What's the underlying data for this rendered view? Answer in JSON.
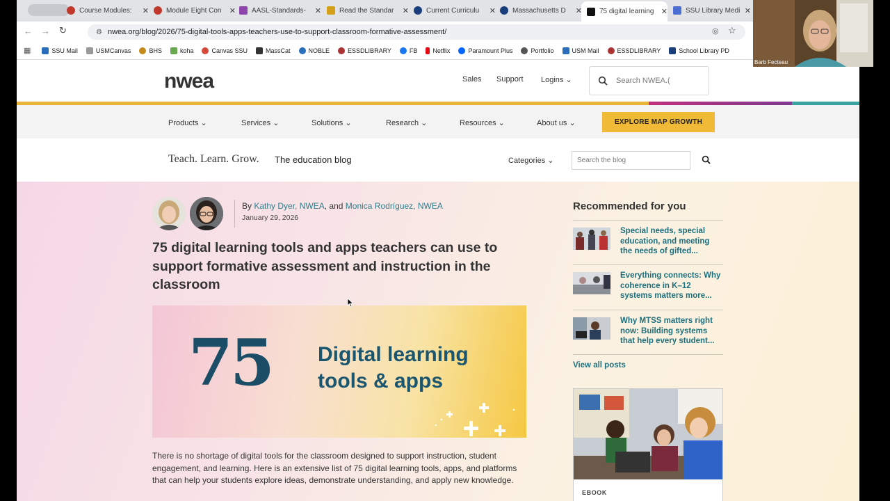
{
  "browser": {
    "tabs": [
      {
        "title": "Course Modules:",
        "color": "#c0392b"
      },
      {
        "title": "Module Eight Con",
        "color": "#c0392b"
      },
      {
        "title": "AASL-Standards-",
        "color": "#8e44ad"
      },
      {
        "title": "Read the Standar",
        "color": "#d4a017"
      },
      {
        "title": "Current Curriculu",
        "color": "#1a3d7c"
      },
      {
        "title": "Massachusetts D",
        "color": "#1a3d7c"
      },
      {
        "title": "75 digital learning",
        "color": "#111111"
      },
      {
        "title": "SSU Library Medi",
        "color": "#4a6fd1"
      }
    ],
    "url": "nwea.org/blog/2026/75-digital-tools-apps-teachers-use-to-support-classroom-formative-assessment/",
    "bookmarks": [
      {
        "label": "SSU Mail",
        "color": "#2a6ebb"
      },
      {
        "label": "USMCanvas",
        "color": "#999999"
      },
      {
        "label": "BHS",
        "color": "#c58a1c"
      },
      {
        "label": "koha",
        "color": "#6aa84f"
      },
      {
        "label": "Canvas SSU",
        "color": "#d64a3a"
      },
      {
        "label": "MassCat",
        "color": "#333333"
      },
      {
        "label": "NOBLE",
        "color": "#2a6ebb"
      },
      {
        "label": "ESSDLIBRARY",
        "color": "#a33"
      },
      {
        "label": "FB",
        "color": "#1877f2"
      },
      {
        "label": "Netflix",
        "color": "#e50914"
      },
      {
        "label": "Paramount Plus",
        "color": "#0064ff"
      },
      {
        "label": "Portfolio",
        "color": "#555555"
      },
      {
        "label": "USM Mail",
        "color": "#2a6ebb"
      },
      {
        "label": "ESSDLIBRARY",
        "color": "#a33"
      },
      {
        "label": "School Library PD",
        "color": "#1a3d7c"
      }
    ]
  },
  "site": {
    "logo": "nwea",
    "header_links": {
      "sales": "Sales",
      "support": "Support",
      "logins": "Logins"
    },
    "search_placeholder": "Search NWEA.(",
    "nav": [
      "Products",
      "Services",
      "Solutions",
      "Research",
      "Resources",
      "About us"
    ],
    "cta": "EXPLORE MAP GROWTH",
    "blog_tagline": "Teach. Learn. Grow.",
    "blog_name": "The education blog",
    "categories": "Categories",
    "blog_search_placeholder": "Search the blog"
  },
  "article": {
    "by": "By",
    "author1": "Kathy Dyer, NWEA",
    "and": ", and",
    "author2": "Monica Rodríguez, NWEA",
    "date": "January 29, 2026",
    "title": "75 digital learning tools and apps teachers can use to support formative assessment and instruction in the classroom",
    "hero_number": "75",
    "hero_text": "Digital learning tools & apps",
    "body": "There is no shortage of digital tools for the classroom designed to support instruction, student engagement, and learning. Here is an extensive list of 75 digital learning tools, apps, and platforms that can help your students explore ideas, demonstrate understanding, and apply new knowledge."
  },
  "sidebar": {
    "heading": "Recommended for you",
    "items": [
      {
        "title": "Special needs, special education, and meeting the needs of gifted..."
      },
      {
        "title": "Everything connects: Why coherence in K–12 systems matters more..."
      },
      {
        "title": "Why MTSS matters right now: Building systems that help every student..."
      }
    ],
    "view_all": "View all posts",
    "ebook_label": "EBOOK"
  },
  "webcam": {
    "name": "Barb Fecteau"
  }
}
